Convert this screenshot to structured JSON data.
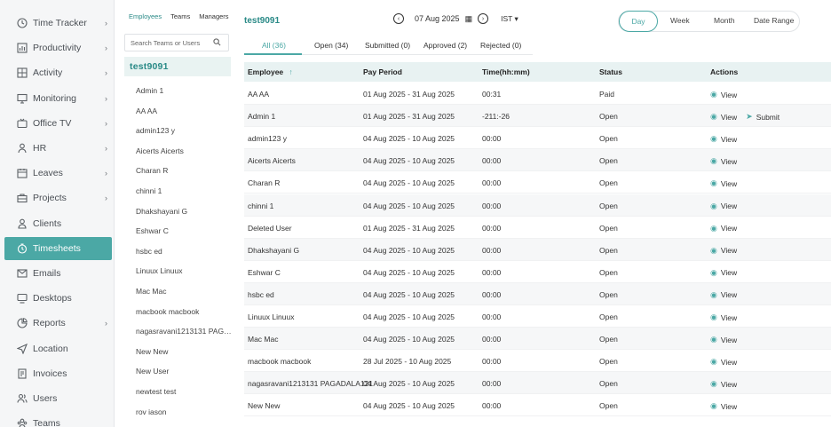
{
  "sidebar": {
    "items": [
      {
        "label": "Time Tracker",
        "icon": "clock-icon",
        "chevron": true,
        "active": false
      },
      {
        "label": "Productivity",
        "icon": "chart-icon",
        "chevron": true,
        "active": false
      },
      {
        "label": "Activity",
        "icon": "activity-icon",
        "chevron": true,
        "active": false
      },
      {
        "label": "Monitoring",
        "icon": "monitor-icon",
        "chevron": true,
        "active": false
      },
      {
        "label": "Office TV",
        "icon": "tv-icon",
        "chevron": true,
        "active": false
      },
      {
        "label": "HR",
        "icon": "person-icon",
        "chevron": true,
        "active": false
      },
      {
        "label": "Leaves",
        "icon": "calendar-icon",
        "chevron": true,
        "active": false
      },
      {
        "label": "Projects",
        "icon": "briefcase-icon",
        "chevron": true,
        "active": false
      },
      {
        "label": "Clients",
        "icon": "user-icon",
        "chevron": false,
        "active": false
      },
      {
        "label": "Timesheets",
        "icon": "timesheet-icon",
        "chevron": false,
        "active": true
      },
      {
        "label": "Emails",
        "icon": "mail-icon",
        "chevron": false,
        "active": false
      },
      {
        "label": "Desktops",
        "icon": "desktop-icon",
        "chevron": false,
        "active": false
      },
      {
        "label": "Reports",
        "icon": "reports-icon",
        "chevron": true,
        "active": false
      },
      {
        "label": "Location",
        "icon": "location-icon",
        "chevron": false,
        "active": false
      },
      {
        "label": "Invoices",
        "icon": "invoice-icon",
        "chevron": false,
        "active": false
      },
      {
        "label": "Users",
        "icon": "users-icon",
        "chevron": false,
        "active": false
      },
      {
        "label": "Teams",
        "icon": "teams-icon",
        "chevron": false,
        "active": false
      }
    ],
    "chevron_glyph": "›"
  },
  "panel": {
    "tabs": [
      "Employees",
      "Teams",
      "Managers"
    ],
    "search_placeholder": "Search Teams or Users",
    "team_name": "test9091",
    "members": [
      "Admin 1",
      "AA AA",
      "admin123 y",
      "Aicerts Aicerts",
      "Charan R",
      "chinni 1",
      "Dhakshayani G",
      "Eshwar C",
      "hsbc ed",
      "Linuux Linuux",
      "Mac Mac",
      "macbook macbook",
      "nagasravani1213131 PAGADALA121",
      "New New",
      "New User",
      "newtest test",
      "rov iason"
    ]
  },
  "header": {
    "team": "test9091",
    "date": "07 Aug 2025",
    "prev_glyph": "‹",
    "next_glyph": "›",
    "calendar_glyph": "▦",
    "timezone": "IST ▾",
    "periods": [
      "Day",
      "Week",
      "Month",
      "Date Range"
    ]
  },
  "status_tabs": [
    "All (36)",
    "Open (34)",
    "Submitted (0)",
    "Approved (2)",
    "Rejected (0)"
  ],
  "table": {
    "columns": [
      "Employee",
      "Pay Period",
      "Time(hh:mm)",
      "Status",
      "Actions"
    ],
    "sort_glyph": "↑",
    "view_label": "View",
    "submit_label": "Submit",
    "eye_glyph": "◉",
    "send_glyph": "➤",
    "rows": [
      {
        "employee": "AA AA",
        "period": "01 Aug 2025 - 31 Aug 2025",
        "time": "00:31",
        "status": "Paid",
        "submit": false
      },
      {
        "employee": "Admin 1",
        "period": "01 Aug 2025 - 31 Aug 2025",
        "time": "-211:-26",
        "status": "Open",
        "submit": true
      },
      {
        "employee": "admin123 y",
        "period": "04 Aug 2025 - 10 Aug 2025",
        "time": "00:00",
        "status": "Open",
        "submit": false
      },
      {
        "employee": "Aicerts Aicerts",
        "period": "04 Aug 2025 - 10 Aug 2025",
        "time": "00:00",
        "status": "Open",
        "submit": false
      },
      {
        "employee": "Charan R",
        "period": "04 Aug 2025 - 10 Aug 2025",
        "time": "00:00",
        "status": "Open",
        "submit": false
      },
      {
        "employee": "chinni 1",
        "period": "04 Aug 2025 - 10 Aug 2025",
        "time": "00:00",
        "status": "Open",
        "submit": false
      },
      {
        "employee": "Deleted User",
        "period": "01 Aug 2025 - 31 Aug 2025",
        "time": "00:00",
        "status": "Open",
        "submit": false
      },
      {
        "employee": "Dhakshayani G",
        "period": "04 Aug 2025 - 10 Aug 2025",
        "time": "00:00",
        "status": "Open",
        "submit": false
      },
      {
        "employee": "Eshwar C",
        "period": "04 Aug 2025 - 10 Aug 2025",
        "time": "00:00",
        "status": "Open",
        "submit": false
      },
      {
        "employee": "hsbc ed",
        "period": "04 Aug 2025 - 10 Aug 2025",
        "time": "00:00",
        "status": "Open",
        "submit": false
      },
      {
        "employee": "Linuux Linuux",
        "period": "04 Aug 2025 - 10 Aug 2025",
        "time": "00:00",
        "status": "Open",
        "submit": false
      },
      {
        "employee": "Mac Mac",
        "period": "04 Aug 2025 - 10 Aug 2025",
        "time": "00:00",
        "status": "Open",
        "submit": false
      },
      {
        "employee": "macbook macbook",
        "period": "28 Jul 2025 - 10 Aug 2025",
        "time": "00:00",
        "status": "Open",
        "submit": false
      },
      {
        "employee": "nagasravani1213131 PAGADALA121",
        "period": "04 Aug 2025 - 10 Aug 2025",
        "time": "00:00",
        "status": "Open",
        "submit": false
      },
      {
        "employee": "New New",
        "period": "04 Aug 2025 - 10 Aug 2025",
        "time": "00:00",
        "status": "Open",
        "submit": false
      }
    ]
  },
  "colors": {
    "accent": "#4ba8a5",
    "accent_dark": "#2a8a87",
    "header_bg": "#e8f2f2"
  }
}
